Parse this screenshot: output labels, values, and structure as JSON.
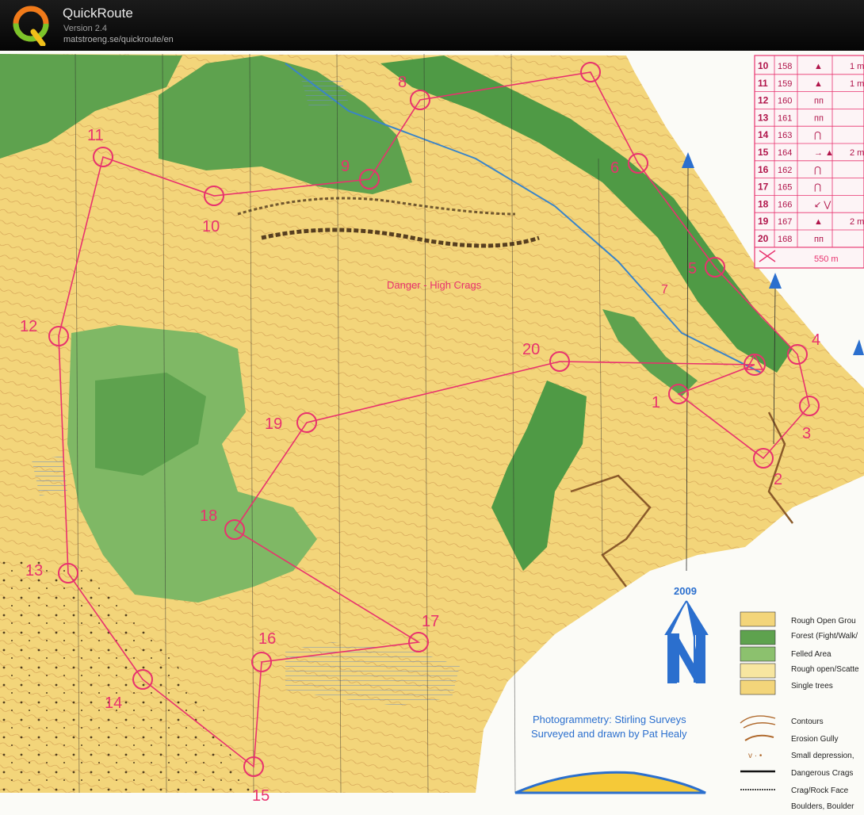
{
  "app": {
    "title": "QuickRoute",
    "version": "Version 2.4",
    "url": "matstroeng.se/quickroute/en"
  },
  "colors": {
    "open": "#f3d57a",
    "rough_open": "#f7e6a0",
    "forest": "#5ea24e",
    "forest_light": "#8cc16e",
    "course": "#e8326e",
    "marsh": "#6c8fc0",
    "water": "#3a84c8",
    "contour": "#b06a2e",
    "north": "#2b6fce"
  },
  "map": {
    "controls": [
      "1",
      "2",
      "3",
      "4",
      "5",
      "6",
      "7",
      "8",
      "9",
      "10",
      "11",
      "12",
      "13",
      "14",
      "15",
      "16",
      "17",
      "18",
      "19",
      "20"
    ],
    "danger_label": "Danger - High Crags",
    "north_year": "2009",
    "photogrammetry": "Photogrammetry: Stirling Surveys",
    "surveyed_by": "Surveyed and drawn by Pat Healy"
  },
  "control_table": {
    "rows": [
      {
        "no": "10",
        "code": "158",
        "clue": "▲",
        "extra": "1 m"
      },
      {
        "no": "11",
        "code": "159",
        "clue": "▲",
        "extra": "1 m"
      },
      {
        "no": "12",
        "code": "160",
        "clue": "ᴨᴨ",
        "extra": ""
      },
      {
        "no": "13",
        "code": "161",
        "clue": "ᴨᴨ",
        "extra": ""
      },
      {
        "no": "14",
        "code": "163",
        "clue": "⋂",
        "extra": ""
      },
      {
        "no": "15",
        "code": "164",
        "clue": "→ ▲",
        "extra": "2 m"
      },
      {
        "no": "16",
        "code": "162",
        "clue": "⋂",
        "extra": ""
      },
      {
        "no": "17",
        "code": "165",
        "clue": "⋂",
        "extra": ""
      },
      {
        "no": "18",
        "code": "166",
        "clue": "↙ ⋁",
        "extra": ""
      },
      {
        "no": "19",
        "code": "167",
        "clue": "▲",
        "extra": "2 m"
      },
      {
        "no": "20",
        "code": "168",
        "clue": "ᴨᴨ",
        "extra": ""
      }
    ],
    "finish_distance": "550 m"
  },
  "legend": {
    "items": [
      "Rough Open Grou",
      "Forest (Fight/Walk/",
      "Felled Area",
      "Rough open/Scatte",
      "Single trees",
      "Contours",
      "Erosion Gully",
      "Small depression,",
      "Dangerous Crags",
      "Crag/Rock Face",
      "Boulders, Boulder"
    ]
  }
}
